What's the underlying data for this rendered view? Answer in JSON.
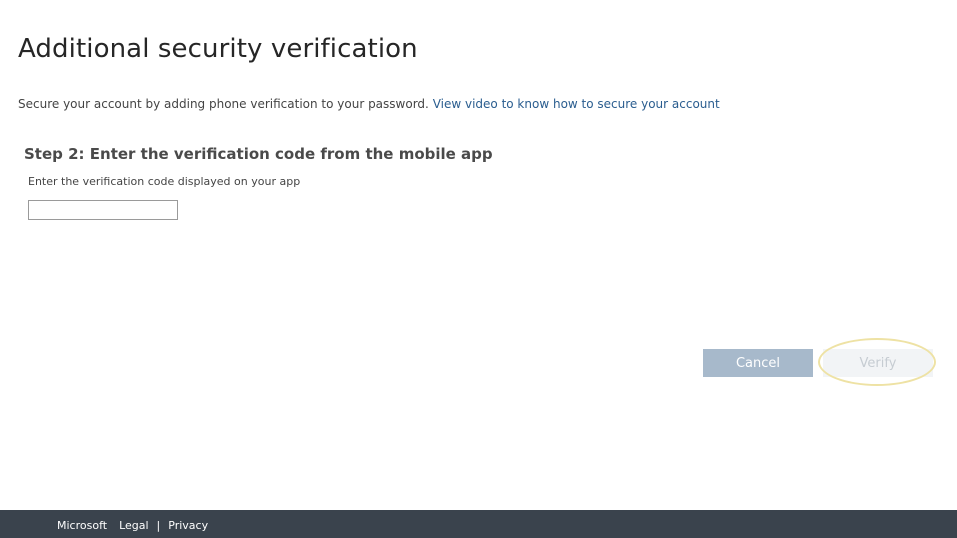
{
  "page": {
    "title": "Additional security verification",
    "intro_text": "Secure your account by adding phone verification to your password.",
    "intro_link": "View video to know how to secure your account"
  },
  "step": {
    "heading": "Step 2: Enter the verification code from the mobile app",
    "label": "Enter the verification code displayed on your app",
    "code_value": ""
  },
  "buttons": {
    "cancel": "Cancel",
    "verify": "Verify"
  },
  "footer": {
    "brand": "Microsoft",
    "legal": "Legal",
    "separator": "|",
    "privacy": "Privacy"
  },
  "colors": {
    "cancel_bg": "#a7b9cb",
    "verify_bg": "#f2f4f6",
    "footer_bg": "#3a434d",
    "link": "#2a5d8f"
  }
}
